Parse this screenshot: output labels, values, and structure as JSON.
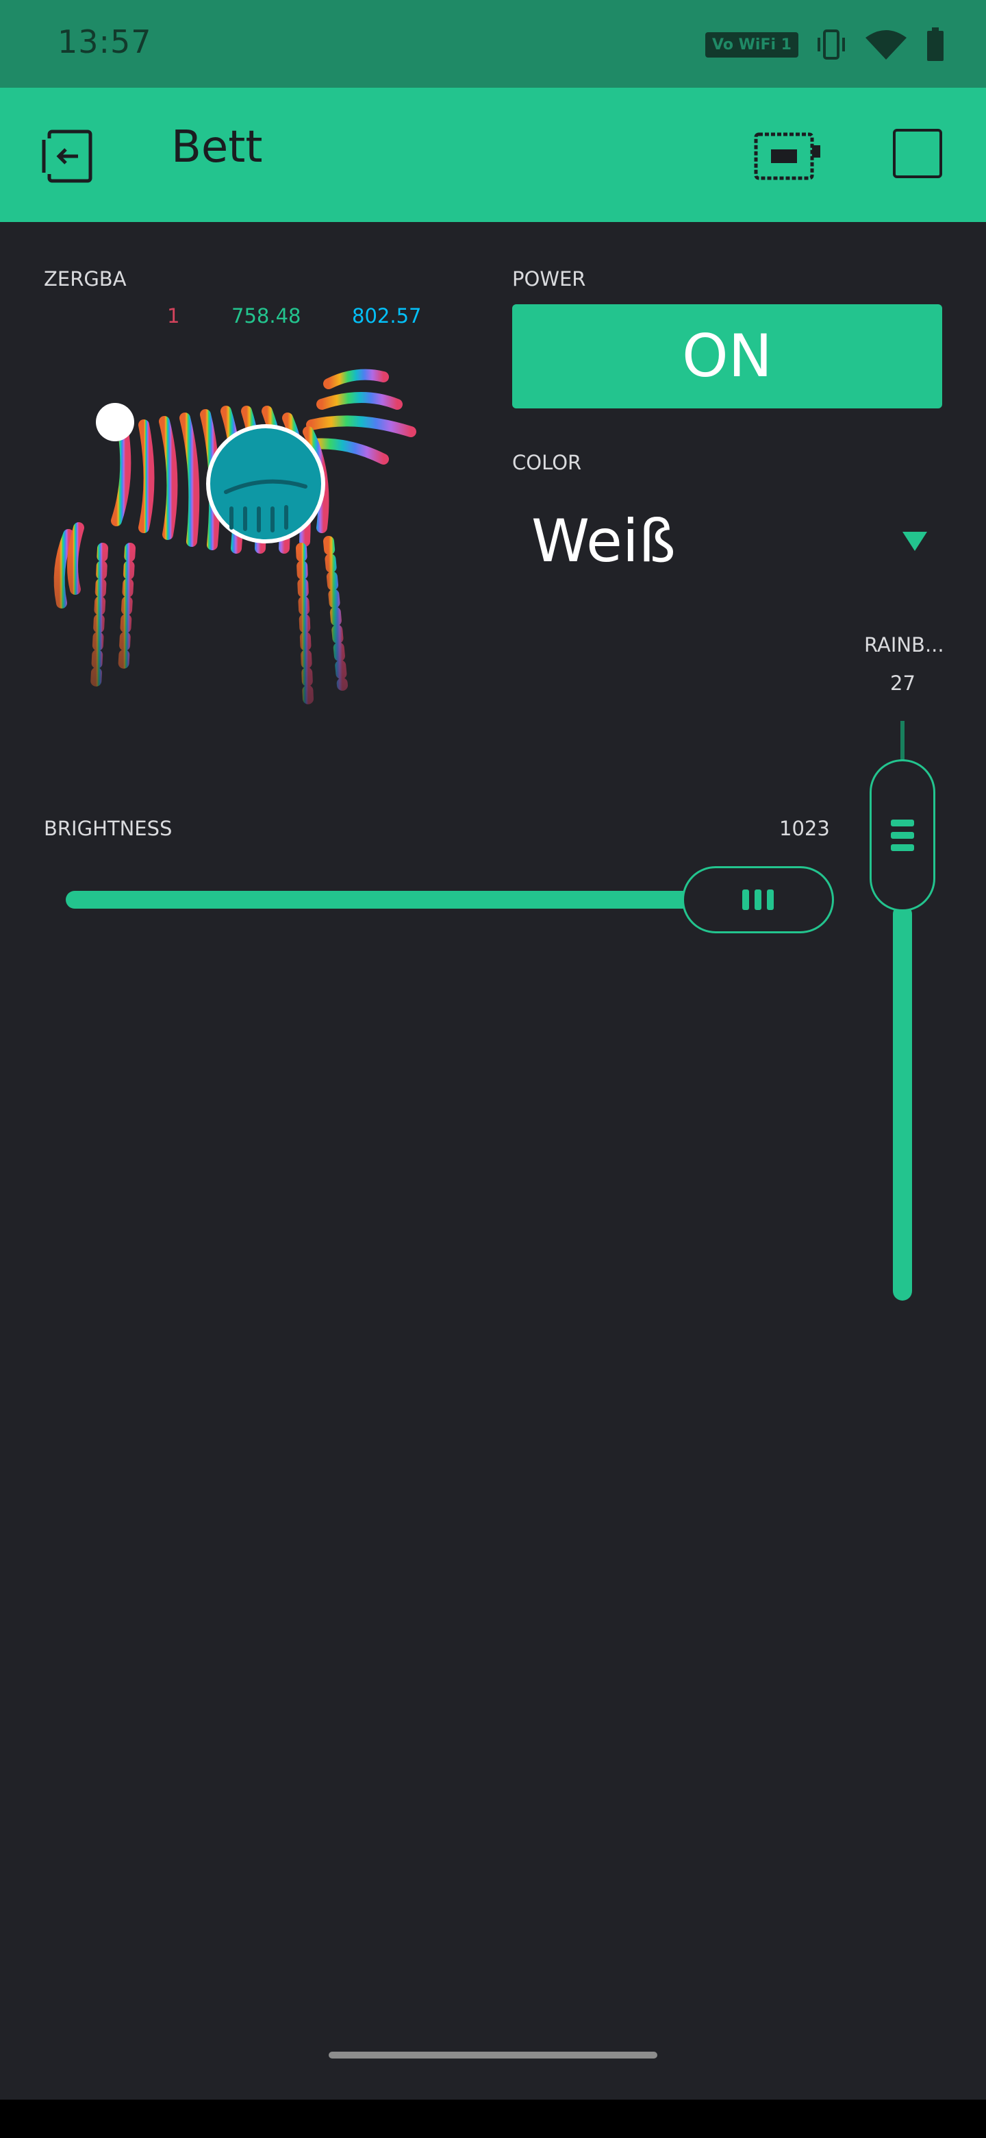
{
  "status_bar": {
    "time": "13:57",
    "volte_label": "Vo WiFi 1",
    "icons": [
      "volte-wifi-icon",
      "vibrate-icon",
      "wifi-signal-icon",
      "battery-icon"
    ]
  },
  "app_bar": {
    "title": "Bett",
    "icons": [
      "back-exit-icon",
      "device-icon",
      "stop-square-icon"
    ]
  },
  "zergba": {
    "label": "ZERGBA",
    "values": {
      "r": "1",
      "g": "758.48",
      "b": "802.57"
    }
  },
  "power": {
    "label": "POWER",
    "button_text": "ON"
  },
  "color": {
    "label": "COLOR",
    "selected": "Weiß"
  },
  "rainbow": {
    "label": "RAINB...",
    "value": "27",
    "level_fraction": 0.74
  },
  "brightness": {
    "label": "BRIGHTNESS",
    "value": "1023",
    "level_fraction": 1.0
  },
  "colors": {
    "accent": "#23c48e",
    "background": "#212227",
    "red": "#d3435c",
    "blue": "#04c0f8"
  }
}
